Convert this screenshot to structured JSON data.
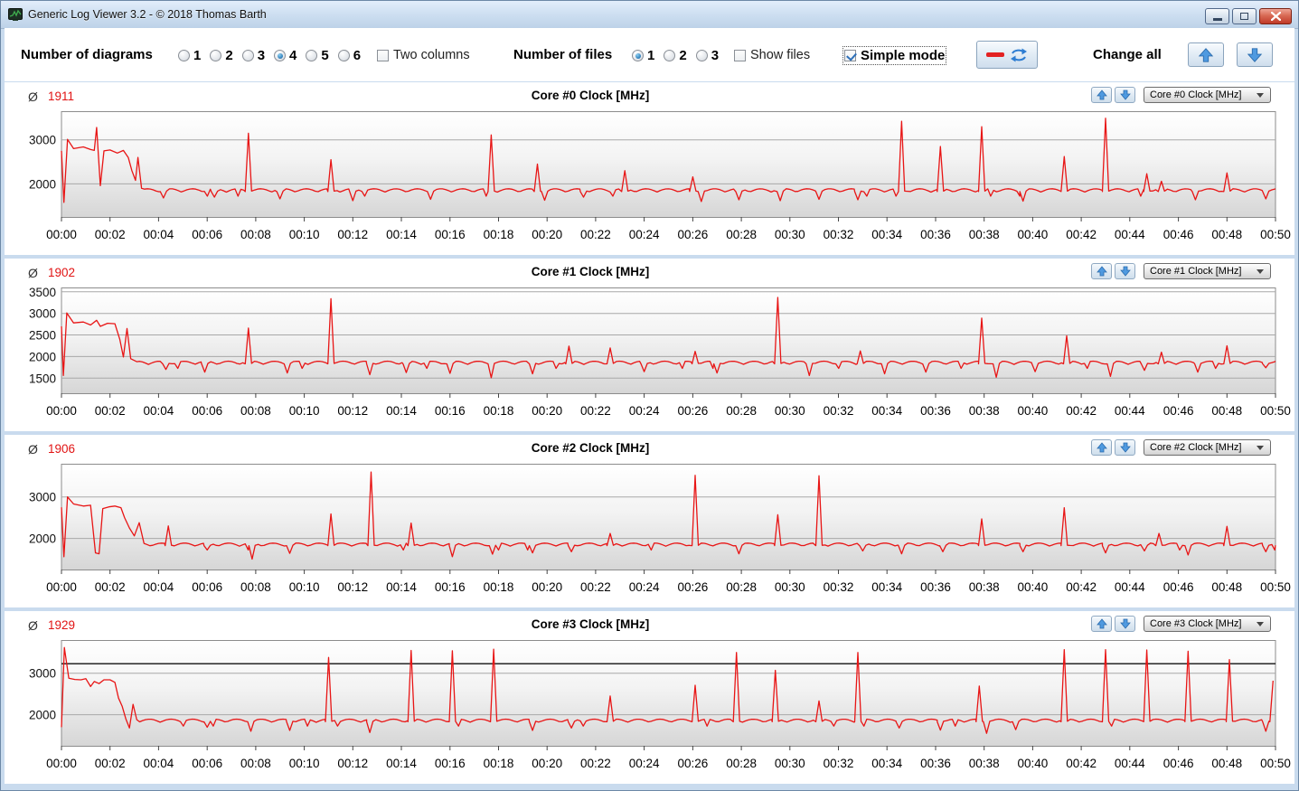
{
  "window": {
    "title": "Generic Log Viewer 3.2 - © 2018 Thomas Barth",
    "icon": "app-logo-chart-icon",
    "controls": [
      "minimize",
      "restore",
      "close"
    ]
  },
  "toolbar": {
    "diagrams_label": "Number of diagrams",
    "diagram_options": [
      "1",
      "2",
      "3",
      "4",
      "5",
      "6"
    ],
    "diagram_selected": "4",
    "two_columns_label": "Two columns",
    "two_columns_checked": false,
    "files_label": "Number of files",
    "file_options": [
      "1",
      "2",
      "3"
    ],
    "file_selected": "1",
    "show_files_label": "Show files",
    "show_files_checked": false,
    "simple_mode_label": "Simple mode",
    "simple_mode_checked": true,
    "change_all_label": "Change all",
    "refresh_button_icons": [
      "red-dash-icon",
      "refresh-arrows-icon"
    ],
    "change_all_icons": [
      "arrow-up-icon",
      "arrow-down-icon"
    ]
  },
  "axis": {
    "x_labels": [
      "00:00",
      "00:02",
      "00:04",
      "00:06",
      "00:08",
      "00:10",
      "00:12",
      "00:14",
      "00:16",
      "00:18",
      "00:20",
      "00:22",
      "00:24",
      "00:26",
      "00:28",
      "00:30",
      "00:32",
      "00:34",
      "00:36",
      "00:38",
      "00:40",
      "00:42",
      "00:44",
      "00:46",
      "00:48",
      "00:50"
    ],
    "x_max_minutes": 50
  },
  "colors": {
    "series_red": "#e81515",
    "average_red": "#e11414",
    "grid_gray": "#a8a8a8",
    "plot_border": "#8c8c8c",
    "marker_black": "#111111",
    "arrow_blue": "#3f8fdd"
  },
  "chart_data": [
    {
      "type": "line",
      "title": "Core #0 Clock [MHz]",
      "average_symbol": "Ø",
      "average": "1911",
      "dropdown_value": "Core #0 Clock [MHz]",
      "y_ticks": [
        2000,
        3000
      ],
      "ylim": [
        1250,
        3650
      ],
      "marker_line": null,
      "baseline": 1852,
      "seed": 1,
      "init_points": [
        [
          0,
          2750
        ],
        [
          0.1,
          1580
        ],
        [
          0.25,
          3010
        ],
        [
          0.5,
          2800
        ],
        [
          0.9,
          2840
        ],
        [
          1.2,
          2780
        ],
        [
          1.35,
          2760
        ],
        [
          1.45,
          3280
        ],
        [
          1.6,
          1960
        ],
        [
          1.75,
          2750
        ],
        [
          2.0,
          2770
        ],
        [
          2.3,
          2700
        ],
        [
          2.55,
          2760
        ],
        [
          2.75,
          2600
        ],
        [
          2.9,
          2300
        ],
        [
          3.05,
          2080
        ],
        [
          3.15,
          2600
        ],
        [
          3.3,
          1900
        ]
      ],
      "spikes": [
        [
          7.7,
          3150
        ],
        [
          11.1,
          2550
        ],
        [
          17.7,
          3110
        ],
        [
          19.6,
          2450
        ],
        [
          23.2,
          2300
        ],
        [
          26.0,
          2160
        ],
        [
          34.6,
          3420
        ],
        [
          36.2,
          2850
        ],
        [
          37.9,
          3300
        ],
        [
          41.3,
          2620
        ],
        [
          43.0,
          3490
        ],
        [
          44.7,
          2230
        ],
        [
          45.3,
          2060
        ],
        [
          48.0,
          2250
        ]
      ],
      "dips": [
        [
          4.2,
          1680
        ],
        [
          6.3,
          1700
        ],
        [
          9.0,
          1660
        ],
        [
          12.0,
          1620
        ],
        [
          15.2,
          1650
        ],
        [
          19.9,
          1630
        ],
        [
          21.5,
          1700
        ],
        [
          26.35,
          1600
        ],
        [
          27.9,
          1640
        ],
        [
          29.6,
          1620
        ],
        [
          31.2,
          1650
        ],
        [
          32.8,
          1640
        ],
        [
          39.6,
          1610
        ],
        [
          46.7,
          1640
        ],
        [
          49.6,
          1660
        ]
      ]
    },
    {
      "type": "line",
      "title": "Core #1 Clock [MHz]",
      "average_symbol": "Ø",
      "average": "1902",
      "dropdown_value": "Core #1 Clock [MHz]",
      "y_ticks": [
        1500,
        2000,
        2500,
        3000,
        3500
      ],
      "ylim": [
        1150,
        3600
      ],
      "marker_line": null,
      "baseline": 1855,
      "seed": 2,
      "init_points": [
        [
          0,
          2700
        ],
        [
          0.08,
          1560
        ],
        [
          0.22,
          3010
        ],
        [
          0.5,
          2780
        ],
        [
          0.9,
          2800
        ],
        [
          1.2,
          2730
        ],
        [
          1.45,
          2840
        ],
        [
          1.6,
          2700
        ],
        [
          1.9,
          2770
        ],
        [
          2.2,
          2760
        ],
        [
          2.4,
          2400
        ],
        [
          2.55,
          1990
        ],
        [
          2.7,
          2650
        ],
        [
          2.85,
          1950
        ],
        [
          3.1,
          1880
        ]
      ],
      "spikes": [
        [
          7.7,
          2660
        ],
        [
          11.1,
          3340
        ],
        [
          20.9,
          2240
        ],
        [
          22.6,
          2200
        ],
        [
          26.1,
          2120
        ],
        [
          29.5,
          3370
        ],
        [
          32.9,
          2130
        ],
        [
          37.9,
          2890
        ],
        [
          41.4,
          2480
        ],
        [
          45.3,
          2100
        ],
        [
          48.0,
          2250
        ]
      ],
      "dips": [
        [
          4.3,
          1700
        ],
        [
          5.9,
          1640
        ],
        [
          9.3,
          1620
        ],
        [
          12.7,
          1580
        ],
        [
          14.2,
          1630
        ],
        [
          16.0,
          1610
        ],
        [
          17.7,
          1510
        ],
        [
          19.4,
          1600
        ],
        [
          24.0,
          1650
        ],
        [
          27.0,
          1620
        ],
        [
          30.8,
          1560
        ],
        [
          33.9,
          1600
        ],
        [
          35.6,
          1640
        ],
        [
          38.5,
          1520
        ],
        [
          40.1,
          1650
        ],
        [
          43.2,
          1540
        ],
        [
          44.6,
          1680
        ],
        [
          46.8,
          1640
        ],
        [
          49.6,
          1740
        ]
      ]
    },
    {
      "type": "line",
      "title": "Core #2 Clock [MHz]",
      "average_symbol": "Ø",
      "average": "1906",
      "dropdown_value": "Core #2 Clock [MHz]",
      "y_ticks": [
        2000,
        3000
      ],
      "ylim": [
        1250,
        3800
      ],
      "marker_line": null,
      "baseline": 1850,
      "seed": 3,
      "init_points": [
        [
          0,
          2750
        ],
        [
          0.1,
          1560
        ],
        [
          0.25,
          3000
        ],
        [
          0.5,
          2830
        ],
        [
          0.9,
          2780
        ],
        [
          1.2,
          2800
        ],
        [
          1.4,
          1650
        ],
        [
          1.55,
          1630
        ],
        [
          1.7,
          2720
        ],
        [
          1.95,
          2760
        ],
        [
          2.2,
          2780
        ],
        [
          2.45,
          2740
        ],
        [
          2.6,
          2500
        ],
        [
          2.8,
          2250
        ],
        [
          3.0,
          2060
        ],
        [
          3.2,
          2380
        ],
        [
          3.4,
          1880
        ]
      ],
      "spikes": [
        [
          4.4,
          2300
        ],
        [
          11.1,
          2590
        ],
        [
          12.75,
          3600
        ],
        [
          14.4,
          2370
        ],
        [
          22.6,
          2120
        ],
        [
          26.1,
          3520
        ],
        [
          29.5,
          2570
        ],
        [
          31.2,
          3510
        ],
        [
          37.9,
          2470
        ],
        [
          41.3,
          2740
        ],
        [
          45.2,
          2120
        ],
        [
          48.0,
          2290
        ]
      ],
      "dips": [
        [
          6.0,
          1720
        ],
        [
          7.85,
          1500
        ],
        [
          9.4,
          1640
        ],
        [
          16.1,
          1560
        ],
        [
          17.75,
          1620
        ],
        [
          19.4,
          1650
        ],
        [
          21.0,
          1680
        ],
        [
          27.9,
          1630
        ],
        [
          33.0,
          1700
        ],
        [
          34.6,
          1630
        ],
        [
          36.3,
          1680
        ],
        [
          39.6,
          1680
        ],
        [
          43.0,
          1650
        ],
        [
          44.6,
          1700
        ],
        [
          46.4,
          1600
        ],
        [
          49.6,
          1680
        ]
      ]
    },
    {
      "type": "line",
      "title": "Core #3 Clock [MHz]",
      "average_symbol": "Ø",
      "average": "1929",
      "dropdown_value": "Core #3 Clock [MHz]",
      "y_ticks": [
        2000,
        3000
      ],
      "ylim": [
        1250,
        3800
      ],
      "marker_line": 3230,
      "baseline": 1855,
      "seed": 4,
      "init_points": [
        [
          0,
          1700
        ],
        [
          0.12,
          3620
        ],
        [
          0.3,
          2880
        ],
        [
          0.55,
          2850
        ],
        [
          0.8,
          2840
        ],
        [
          1.0,
          2870
        ],
        [
          1.2,
          2680
        ],
        [
          1.35,
          2800
        ],
        [
          1.55,
          2750
        ],
        [
          1.75,
          2840
        ],
        [
          2.0,
          2840
        ],
        [
          2.2,
          2780
        ],
        [
          2.35,
          2400
        ],
        [
          2.5,
          2200
        ],
        [
          2.65,
          1900
        ],
        [
          2.8,
          1680
        ],
        [
          2.95,
          2250
        ],
        [
          3.1,
          1880
        ]
      ],
      "spikes": [
        [
          11.0,
          3380
        ],
        [
          14.4,
          3550
        ],
        [
          16.1,
          3540
        ],
        [
          17.8,
          3580
        ],
        [
          22.6,
          2450
        ],
        [
          26.1,
          2710
        ],
        [
          27.8,
          3500
        ],
        [
          29.4,
          3070
        ],
        [
          31.2,
          2330
        ],
        [
          32.8,
          3500
        ],
        [
          37.8,
          2690
        ],
        [
          41.3,
          3570
        ],
        [
          43.0,
          3570
        ],
        [
          44.7,
          3560
        ],
        [
          46.4,
          3530
        ],
        [
          48.1,
          3330
        ],
        [
          49.9,
          2820
        ]
      ],
      "dips": [
        [
          6.0,
          1700
        ],
        [
          7.8,
          1600
        ],
        [
          9.4,
          1620
        ],
        [
          12.7,
          1570
        ],
        [
          19.4,
          1620
        ],
        [
          21.0,
          1680
        ],
        [
          34.5,
          1680
        ],
        [
          36.2,
          1630
        ],
        [
          38.1,
          1550
        ],
        [
          39.3,
          1640
        ],
        [
          49.6,
          1600
        ]
      ]
    }
  ]
}
